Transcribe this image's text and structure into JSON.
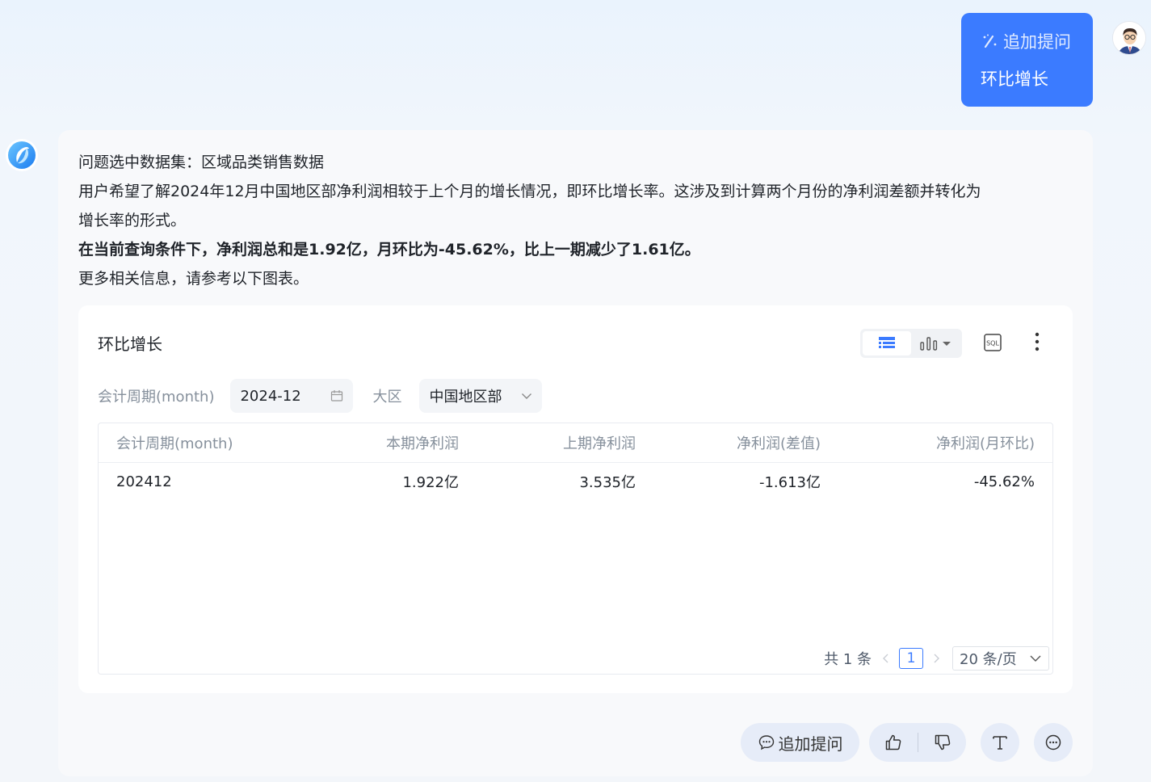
{
  "user_message": {
    "tag_label": "追加提问",
    "text": "环比增长"
  },
  "answer": {
    "line1": "问题选中数据集：区域品类销售数据",
    "line2": "用户希望了解2024年12月中国地区部净利润相较于上个月的增长情况，即环比增长率。这涉及到计算两个月份的净利润差额并转化为",
    "line3": "增长率的形式。",
    "line4_bold": "在当前查询条件下，净利润总和是1.92亿，月环比为-45.62%，比上一期减少了1.61亿。",
    "line5": "更多相关信息，请参考以下图表。"
  },
  "panel": {
    "title": "环比增长",
    "sql_label": "SQL",
    "filters": {
      "period_label": "会计周期(month)",
      "period_value": "2024-12",
      "region_label": "大区",
      "region_value": "中国地区部"
    },
    "table": {
      "headers": [
        "会计周期(month)",
        "本期净利润",
        "上期净利润",
        "净利润(差值)",
        "净利润(月环比)"
      ],
      "rows": [
        [
          "202412",
          "1.922亿",
          "3.535亿",
          "-1.613亿",
          "-45.62%"
        ]
      ]
    },
    "pagination": {
      "total_text": "共 1 条",
      "current_page": "1",
      "page_size": "20 条/页"
    }
  },
  "actions": {
    "follow_up_label": "追加提问"
  },
  "colors": {
    "accent": "#3b7bff",
    "pill_bg": "#e6ecf8"
  }
}
